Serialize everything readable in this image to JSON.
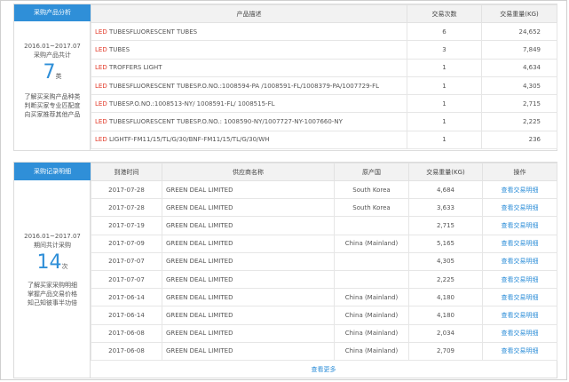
{
  "products": {
    "tag": "采购产品分析",
    "left": {
      "period": "2016.01~2017.07",
      "caption": "采购产品共计",
      "count": "7",
      "unit": "类",
      "desc": [
        "了解买采购产品种类",
        "判断买家专业匹配度",
        "向买家推荐其他产品"
      ]
    },
    "headers": [
      "产品描述",
      "交易次数",
      "交易重量(KG)"
    ],
    "rows": [
      {
        "prefix": "LED",
        "text": " TUBESFLUORESCENT TUBES",
        "count": "6",
        "weight": "24,652"
      },
      {
        "prefix": "LED",
        "text": " TUBES",
        "count": "3",
        "weight": "7,849"
      },
      {
        "prefix": "LED",
        "text": " TROFFERS LIGHT",
        "count": "1",
        "weight": "4,634"
      },
      {
        "prefix": "LED",
        "text": " TUBESFLUORESCENT TUBESP.O.NO.:1008594-PA /1008591-FL/1008379-PA/1007729-FL",
        "count": "1",
        "weight": "4,305"
      },
      {
        "prefix": "LED",
        "text": " TUBESP.O.NO.:1008513-NY/ 1008591-FL/ 1008515-FL",
        "count": "1",
        "weight": "2,715"
      },
      {
        "prefix": "LED",
        "text": " TUBESFLUORESCENT TUBESP.O.NO.: 1008590-NY/1007727-NY-1007660-NY",
        "count": "1",
        "weight": "2,225"
      },
      {
        "prefix": "LED",
        "text": " LIGHTF-FM11/15/TL/G/30/BNF-FM11/15/TL/G/30/WH",
        "count": "1",
        "weight": "236"
      }
    ]
  },
  "records": {
    "tag": "采购记录明细",
    "left": {
      "period": "2016.01~2017.07",
      "caption": "期间共计采购",
      "count": "14",
      "unit": "次",
      "desc": [
        "了解买家采购明细",
        "掌握产品交易价格",
        "知己知彼事半功倍"
      ]
    },
    "headers": [
      "到港时间",
      "供应商名称",
      "原产国",
      "交易重量(KG)",
      "操作"
    ],
    "rows": [
      {
        "date": "2017-07-28",
        "supplier": "GREEN DEAL LIMITED",
        "origin": "South Korea",
        "weight": "4,684",
        "action": "查看交易明细"
      },
      {
        "date": "2017-07-28",
        "supplier": "GREEN DEAL LIMITED",
        "origin": "South Korea",
        "weight": "3,633",
        "action": "查看交易明细"
      },
      {
        "date": "2017-07-19",
        "supplier": "GREEN DEAL LIMITED",
        "origin": "",
        "weight": "2,715",
        "action": "查看交易明细"
      },
      {
        "date": "2017-07-09",
        "supplier": "GREEN DEAL LIMITED",
        "origin": "China (Mainland)",
        "weight": "5,165",
        "action": "查看交易明细"
      },
      {
        "date": "2017-07-07",
        "supplier": "GREEN DEAL LIMITED",
        "origin": "",
        "weight": "4,305",
        "action": "查看交易明细"
      },
      {
        "date": "2017-07-07",
        "supplier": "GREEN DEAL LIMITED",
        "origin": "",
        "weight": "2,225",
        "action": "查看交易明细"
      },
      {
        "date": "2017-06-14",
        "supplier": "GREEN DEAL LIMITED",
        "origin": "China (Mainland)",
        "weight": "4,180",
        "action": "查看交易明细"
      },
      {
        "date": "2017-06-14",
        "supplier": "GREEN DEAL LIMITED",
        "origin": "China (Mainland)",
        "weight": "4,180",
        "action": "查看交易明细"
      },
      {
        "date": "2017-06-08",
        "supplier": "GREEN DEAL LIMITED",
        "origin": "China (Mainland)",
        "weight": "2,034",
        "action": "查看交易明细"
      },
      {
        "date": "2017-06-08",
        "supplier": "GREEN DEAL LIMITED",
        "origin": "China (Mainland)",
        "weight": "2,709",
        "action": "查看交易明细"
      }
    ],
    "more": "查看更多"
  },
  "colors": {
    "accent": "#2f8fd8",
    "led_red": "#e23b2a",
    "header_bg": "#f2f2f2"
  }
}
